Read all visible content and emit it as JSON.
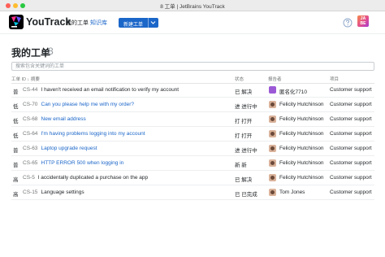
{
  "window": {
    "title": "8 工单 | JetBrains YouTrack"
  },
  "header": {
    "brand": "YouTrack",
    "nav": {
      "issues": "我的工单",
      "knowledge_base": "知识库"
    },
    "new_issue_button": "新建工单",
    "avatar_text_line1": "JA",
    "avatar_text_line2": "BE",
    "help_icon": "help-circle-icon",
    "accent_color": "#1b66c9"
  },
  "page": {
    "title": "我的工单",
    "count": "8"
  },
  "search": {
    "placeholder": "搜索包含关键词的工单",
    "value": ""
  },
  "table": {
    "columns": {
      "id_summary": "工单 ID ↓ 摘要",
      "state": "状态",
      "reporter": "报告者",
      "project": "项目"
    },
    "rows": [
      {
        "priority": "普",
        "id": "CS-44",
        "summary": "I haven't received an email notification to verify my account",
        "summary_is_link": false,
        "state": "已 解决",
        "reporter": "匿名化7710",
        "reporter_avatar": "anonymous",
        "project": "Customer support"
      },
      {
        "priority": "低",
        "id": "CS-70",
        "summary": "Can you please help me with my order?",
        "summary_is_link": true,
        "state": "进 进行中",
        "reporter": "Felicity Hutchinson",
        "reporter_avatar": "photo",
        "project": "Customer support"
      },
      {
        "priority": "低",
        "id": "CS-68",
        "summary": "New email address",
        "summary_is_link": true,
        "state": "打 打开",
        "reporter": "Felicity Hutchinson",
        "reporter_avatar": "photo",
        "project": "Customer support"
      },
      {
        "priority": "低",
        "id": "CS-64",
        "summary": "I'm having problems logging into my account",
        "summary_is_link": true,
        "state": "打 打开",
        "reporter": "Felicity Hutchinson",
        "reporter_avatar": "photo",
        "project": "Customer support"
      },
      {
        "priority": "普",
        "id": "CS-63",
        "summary": "Laptop upgrade request",
        "summary_is_link": true,
        "state": "进 进行中",
        "reporter": "Felicity Hutchinson",
        "reporter_avatar": "photo",
        "project": "Customer support"
      },
      {
        "priority": "普",
        "id": "CS-65",
        "summary": "HTTP ERROR 500 when logging in",
        "summary_is_link": true,
        "state": "新 新",
        "reporter": "Felicity Hutchinson",
        "reporter_avatar": "photo",
        "project": "Customer support"
      },
      {
        "priority": "高",
        "id": "CS-5",
        "summary": "I accidentally duplicated a purchase on the app",
        "summary_is_link": false,
        "state": "已 解决",
        "reporter": "Felicity Hutchinson",
        "reporter_avatar": "photo",
        "project": "Customer support"
      },
      {
        "priority": "高",
        "id": "CS-15",
        "summary": "Language settings",
        "summary_is_link": false,
        "state": "已 已完成",
        "reporter": "Tom Jones",
        "reporter_avatar": "photo",
        "project": "Customer support"
      }
    ]
  }
}
